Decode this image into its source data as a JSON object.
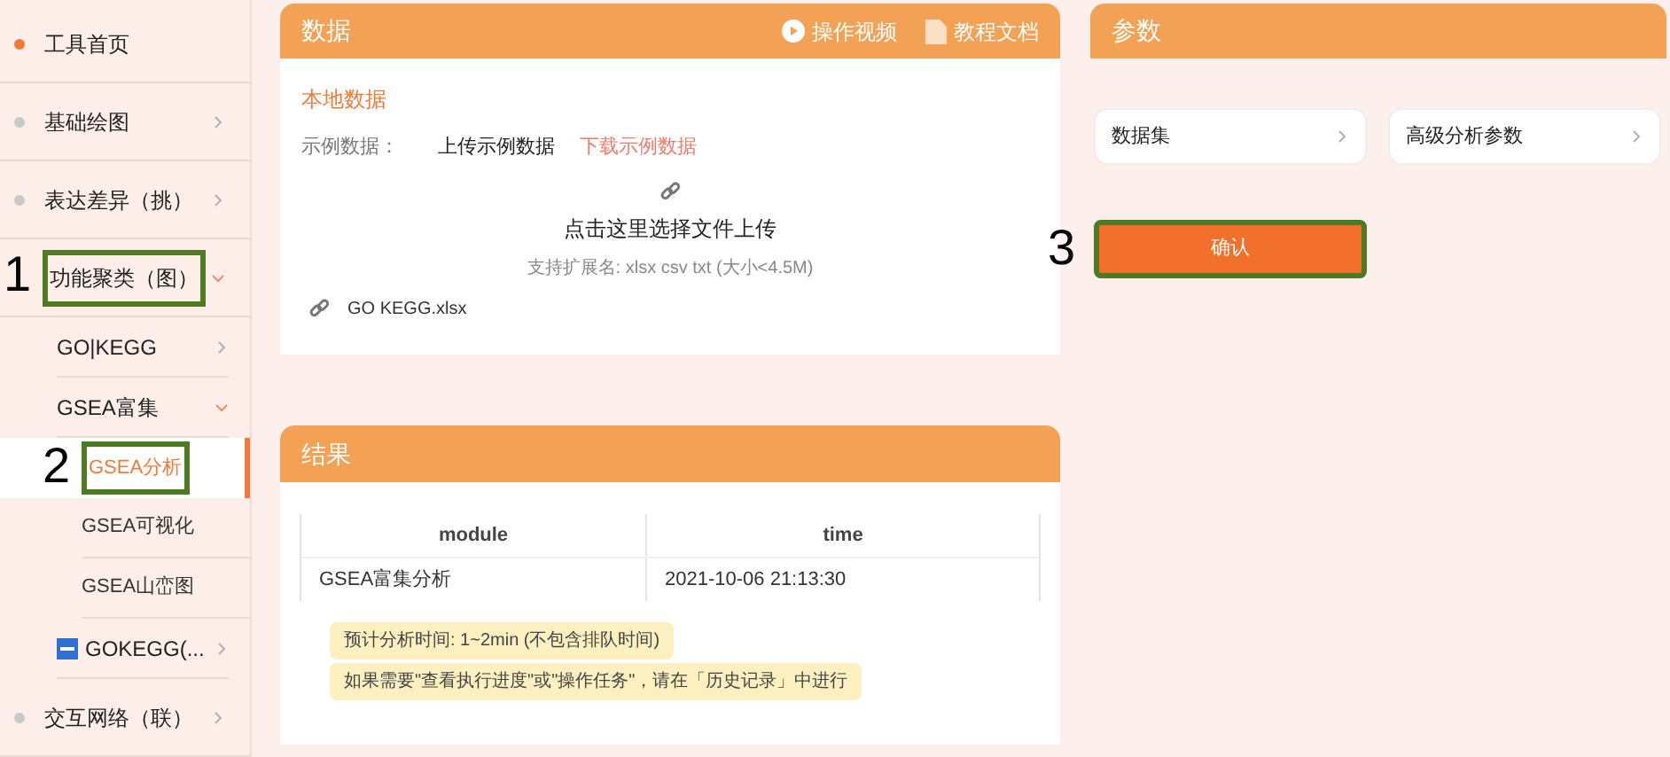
{
  "sidebar": {
    "items": [
      {
        "label": "工具首页",
        "color": "#f07a3a"
      },
      {
        "label": "基础绘图",
        "color": "#c8c8c8",
        "expanded": false
      },
      {
        "label": "表达差异（挑）",
        "color": "#c8c8c8",
        "expanded": false
      },
      {
        "label": "功能聚类（图）",
        "expanded": true,
        "callout": "1",
        "children": [
          {
            "label": "GO|KEGG",
            "expanded": false
          },
          {
            "label": "GSEA富集",
            "expanded": true,
            "children": [
              {
                "label": "GSEA分析",
                "selected": true,
                "callout": "2"
              },
              {
                "label": "GSEA可视化",
                "selected": false
              },
              {
                "label": "GSEA山峦图",
                "selected": false
              }
            ]
          },
          {
            "label": "GOKEGG(...",
            "expanded": false,
            "kind": "icon"
          }
        ]
      },
      {
        "label": "交互网络（联）",
        "color": "#c8c8c8",
        "expanded": false
      }
    ]
  },
  "data_panel": {
    "title": "数据",
    "links": [
      {
        "label": "操作视频",
        "kind": "video"
      },
      {
        "label": "教程文档",
        "kind": "pdf"
      }
    ],
    "source_tab": "本地数据",
    "example_label": "示例数据：",
    "upload_example": "上传示例数据",
    "download_example": "下载示例数据",
    "upload_prompt": "点击这里选择文件上传",
    "upload_hint": "支持扩展名: xlsx csv txt (大小<4.5M)",
    "file": "GO KEGG.xlsx"
  },
  "result_panel": {
    "title": "结果",
    "table": {
      "columns": [
        "module",
        "time"
      ],
      "rows": [
        [
          "GSEA富集分析",
          "2021-10-06 21:13:30"
        ]
      ]
    },
    "notes": [
      "预计分析时间: 1~2min (不包含排队时间)",
      "如果需要\"查看执行进度\"或\"操作任务\"，请在「历史记录」中进行"
    ]
  },
  "params_panel": {
    "title": "参数",
    "selects": [
      "数据集",
      "高级分析参数"
    ],
    "confirm": {
      "label": "确认",
      "callout": "3"
    }
  }
}
